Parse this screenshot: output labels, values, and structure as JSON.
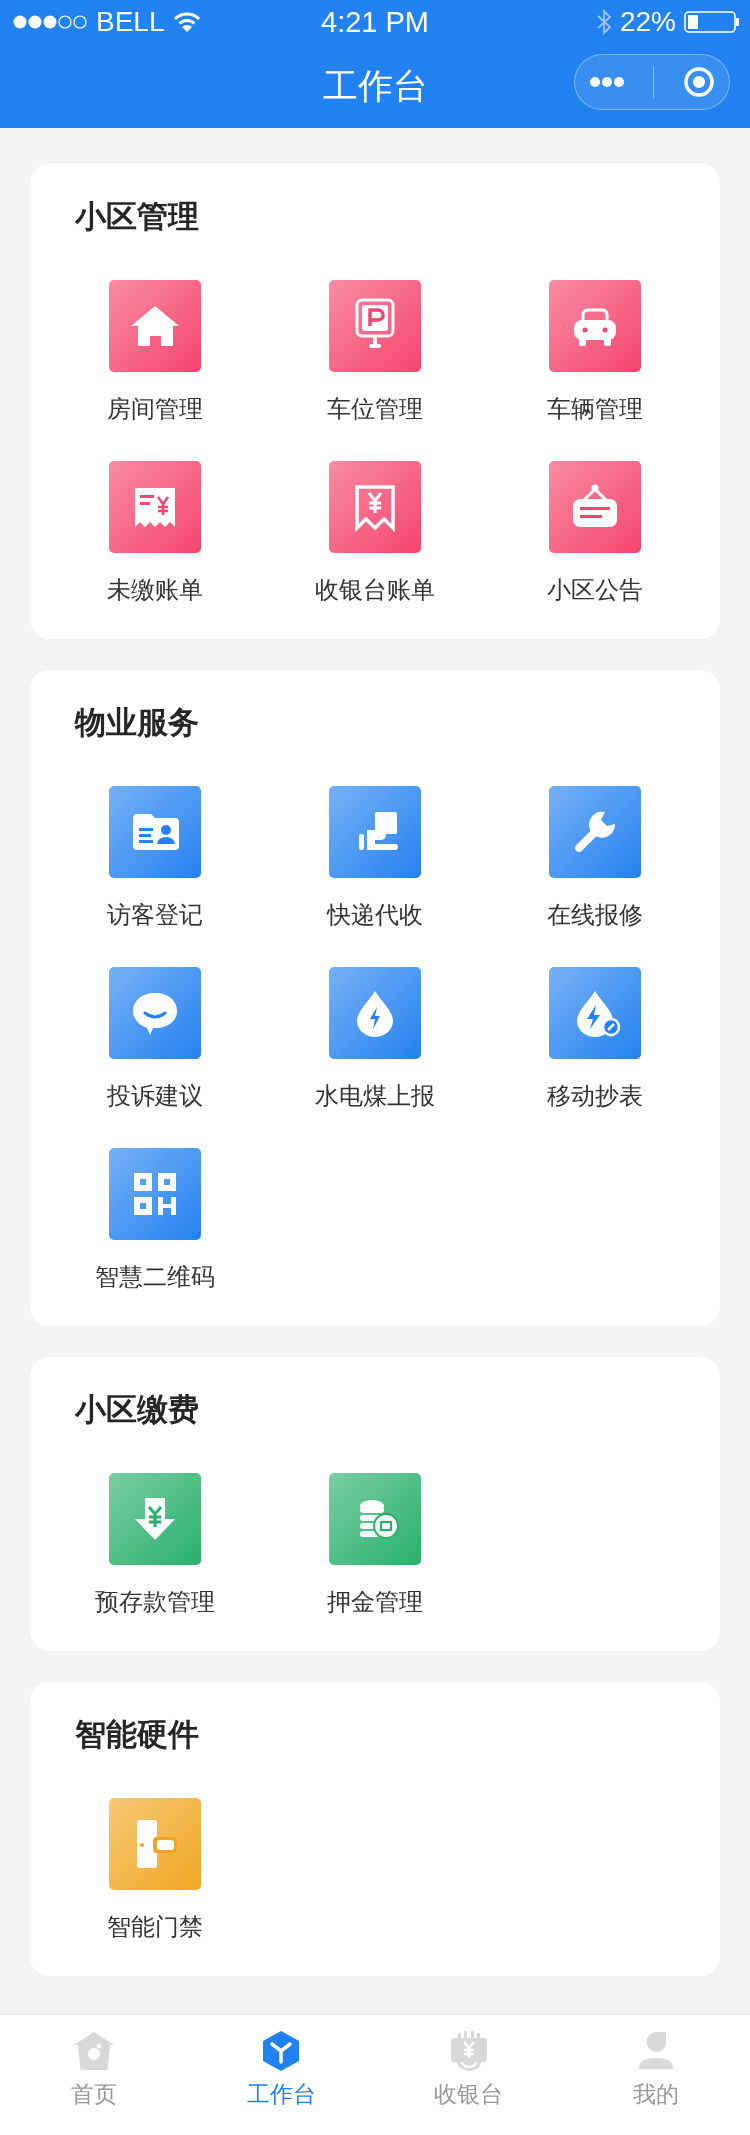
{
  "status_bar": {
    "carrier": "BELL",
    "time": "4:21 PM",
    "battery": "22%"
  },
  "nav": {
    "title": "工作台"
  },
  "sections": [
    {
      "title": "小区管理",
      "color": "#f5456d",
      "items": [
        {
          "label": "房间管理",
          "kind": "house"
        },
        {
          "label": "车位管理",
          "kind": "parking"
        },
        {
          "label": "车辆管理",
          "kind": "car"
        },
        {
          "label": "未缴账单",
          "kind": "bill"
        },
        {
          "label": "收银台账单",
          "kind": "receipt"
        },
        {
          "label": "小区公告",
          "kind": "sign"
        }
      ]
    },
    {
      "title": "物业服务",
      "color": "#2481f0",
      "items": [
        {
          "label": "访客登记",
          "kind": "card"
        },
        {
          "label": "快递代收",
          "kind": "parcel"
        },
        {
          "label": "在线报修",
          "kind": "wrench"
        },
        {
          "label": "投诉建议",
          "kind": "chat"
        },
        {
          "label": "水电煤上报",
          "kind": "drop"
        },
        {
          "label": "移动抄表",
          "kind": "meter"
        },
        {
          "label": "智慧二维码",
          "kind": "qr"
        }
      ]
    },
    {
      "title": "小区缴费",
      "color": "#29b06a",
      "items": [
        {
          "label": "预存款管理",
          "kind": "deposit"
        },
        {
          "label": "押金管理",
          "kind": "coins"
        }
      ]
    },
    {
      "title": "智能硬件",
      "color": "#f0a623",
      "items": [
        {
          "label": "智能门禁",
          "kind": "door"
        }
      ]
    }
  ],
  "tab_bar": [
    {
      "label": "首页",
      "kind": "home",
      "selected": false
    },
    {
      "label": "工作台",
      "kind": "workbench",
      "selected": true
    },
    {
      "label": "收银台",
      "kind": "register",
      "selected": false
    },
    {
      "label": "我的",
      "kind": "profile",
      "selected": false
    }
  ]
}
